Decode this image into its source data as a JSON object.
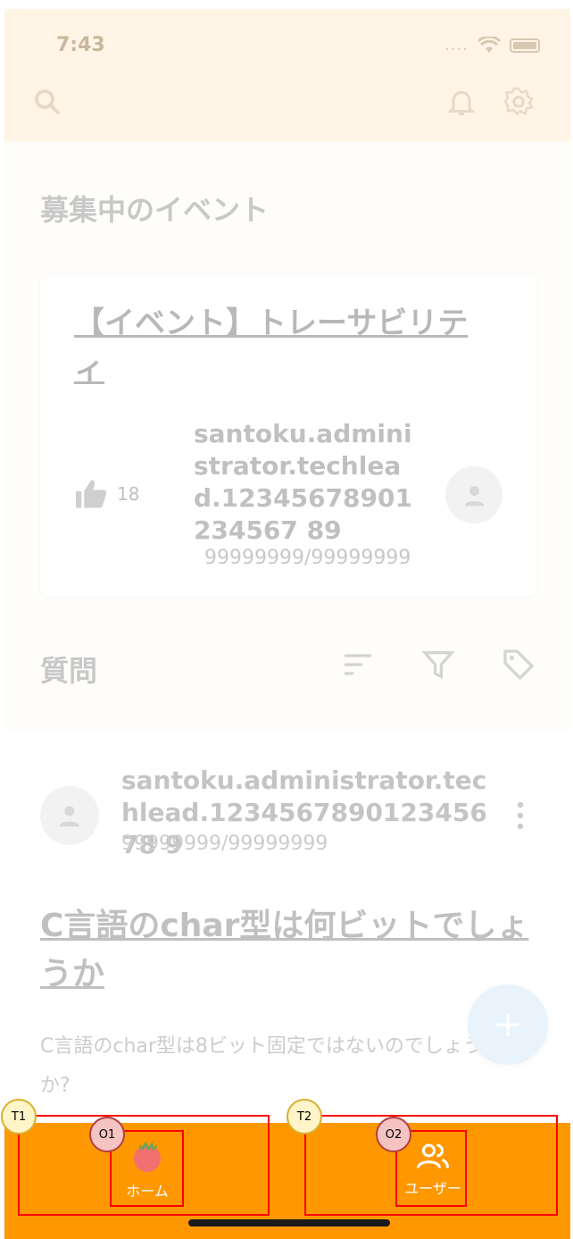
{
  "status_bar": {
    "time": "7:43",
    "signal": "...."
  },
  "header": {
    "search_icon": "search-icon",
    "bell_icon": "bell-icon",
    "settings_icon": "gear-icon"
  },
  "events": {
    "section_title": "募集中のイベント",
    "card": {
      "title": "【イベント】トレーサビリティ",
      "likes": "18",
      "user": "santoku.administrator.techlead.12345678901234567 89",
      "points": "99999999/99999999"
    }
  },
  "questions": {
    "section_title": "質問",
    "tools": [
      "sort-icon",
      "filter-icon",
      "tag-icon"
    ],
    "item": {
      "user": "santoku.administrator.techlead.123456789012345678 9",
      "points": "99999999/99999999",
      "title": "C言語のchar型は何ビットでしょうか",
      "body": "C言語のchar型は8ビット固定ではないのでしょうか?"
    }
  },
  "fab": {
    "label": "+"
  },
  "tabbar": {
    "tabs": [
      {
        "label": "ホーム",
        "icon": "tomato-icon"
      },
      {
        "label": "ユーザー",
        "icon": "users-icon"
      }
    ]
  },
  "annotations": {
    "t1": "T1",
    "o1": "O1",
    "t2": "T2",
    "o2": "O2"
  },
  "colors": {
    "accent": "#ff9800",
    "header_bg": "#fff4e5",
    "annotation": "#ff0000"
  }
}
